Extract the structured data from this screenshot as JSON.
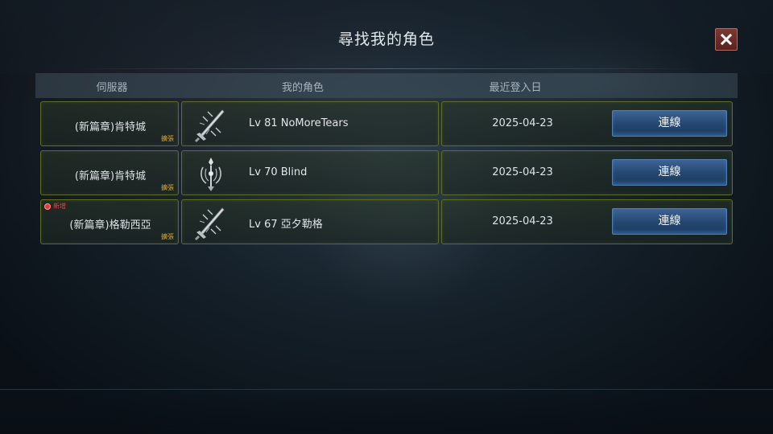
{
  "dialog": {
    "title": "尋找我的角色",
    "close_icon": "close-x-icon",
    "colors": {
      "row_border": "#5f6d27",
      "button": "#2c5282",
      "close_button": "#7d3934",
      "server_tag": "#d9a630",
      "new_badge": "#e0474a"
    }
  },
  "columns": {
    "server": "伺服器",
    "character": "我的角色",
    "last_login": "最近登入日"
  },
  "rows": [
    {
      "server": "(新篇章)肯特城",
      "server_tag": "擴張",
      "new_badge": "",
      "class_icon": "sword-emblem-icon",
      "character": "Lv 81 NoMoreTears",
      "last_login": "2025-04-23",
      "button": "連線"
    },
    {
      "server": "(新篇章)肯特城",
      "server_tag": "擴張",
      "new_badge": "",
      "class_icon": "staff-emblem-icon",
      "character": "Lv 70 Blind",
      "last_login": "2025-04-23",
      "button": "連線"
    },
    {
      "server": "(新篇章)格勒西亞",
      "server_tag": "擴張",
      "new_badge": "新增",
      "class_icon": "sword-emblem-icon",
      "character": "Lv 67 亞夕勒格",
      "last_login": "2025-04-23",
      "button": "連線"
    }
  ]
}
